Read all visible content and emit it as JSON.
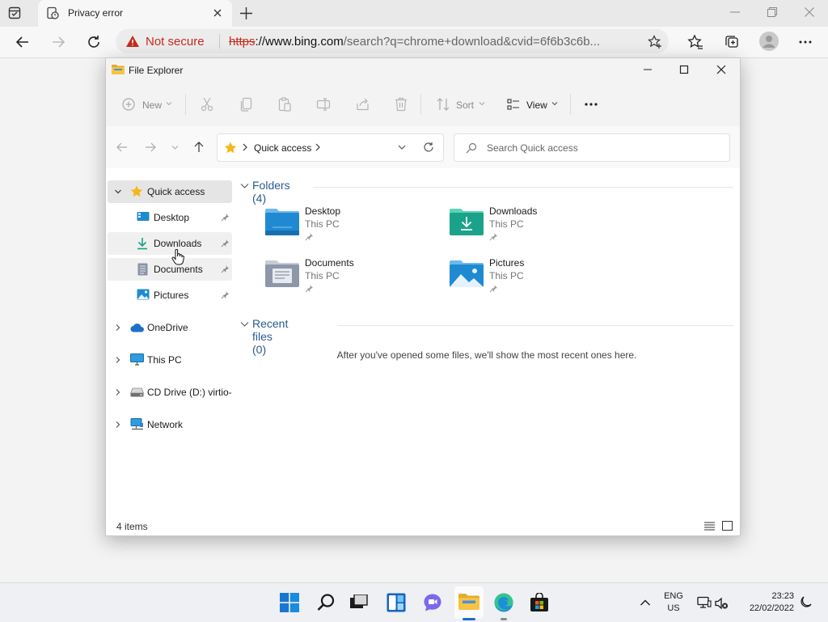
{
  "browser": {
    "tab_title": "Privacy error",
    "security_label": "Not secure",
    "url_scheme": "https",
    "url_domain": "://www.bing.com",
    "url_path": "/search?q=chrome+download&cvid=6f6b3c6b..."
  },
  "explorer": {
    "title": "File Explorer",
    "commands": {
      "new": "New",
      "sort": "Sort",
      "view": "View"
    },
    "breadcrumb": "Quick access",
    "search_placeholder": "Search Quick access",
    "sidebar": [
      {
        "label": "Quick access",
        "icon": "star-icon"
      },
      {
        "label": "Desktop",
        "icon": "desktop-icon"
      },
      {
        "label": "Downloads",
        "icon": "download-icon"
      },
      {
        "label": "Documents",
        "icon": "documents-icon"
      },
      {
        "label": "Pictures",
        "icon": "pictures-icon"
      },
      {
        "label": "OneDrive",
        "icon": "cloud-icon"
      },
      {
        "label": "This PC",
        "icon": "pc-icon"
      },
      {
        "label": "CD Drive (D:) virtio-",
        "icon": "drive-icon"
      },
      {
        "label": "Network",
        "icon": "network-icon"
      }
    ],
    "folders_heading": "Folders (4)",
    "folders": [
      {
        "name": "Desktop",
        "location": "This PC"
      },
      {
        "name": "Downloads",
        "location": "This PC"
      },
      {
        "name": "Documents",
        "location": "This PC"
      },
      {
        "name": "Pictures",
        "location": "This PC"
      }
    ],
    "recent_heading": "Recent files (0)",
    "recent_empty": "After you've opened some files, we'll show the most recent ones here.",
    "status_count": "4 items"
  },
  "taskbar": {
    "lang_line1": "ENG",
    "lang_line2": "US",
    "time": "23:23",
    "date": "22/02/2022"
  },
  "colors": {
    "accent": "#0067c0",
    "danger": "#c42b1c",
    "folder_blue": "#2f8fd6",
    "folder_teal": "#1aa38a"
  }
}
